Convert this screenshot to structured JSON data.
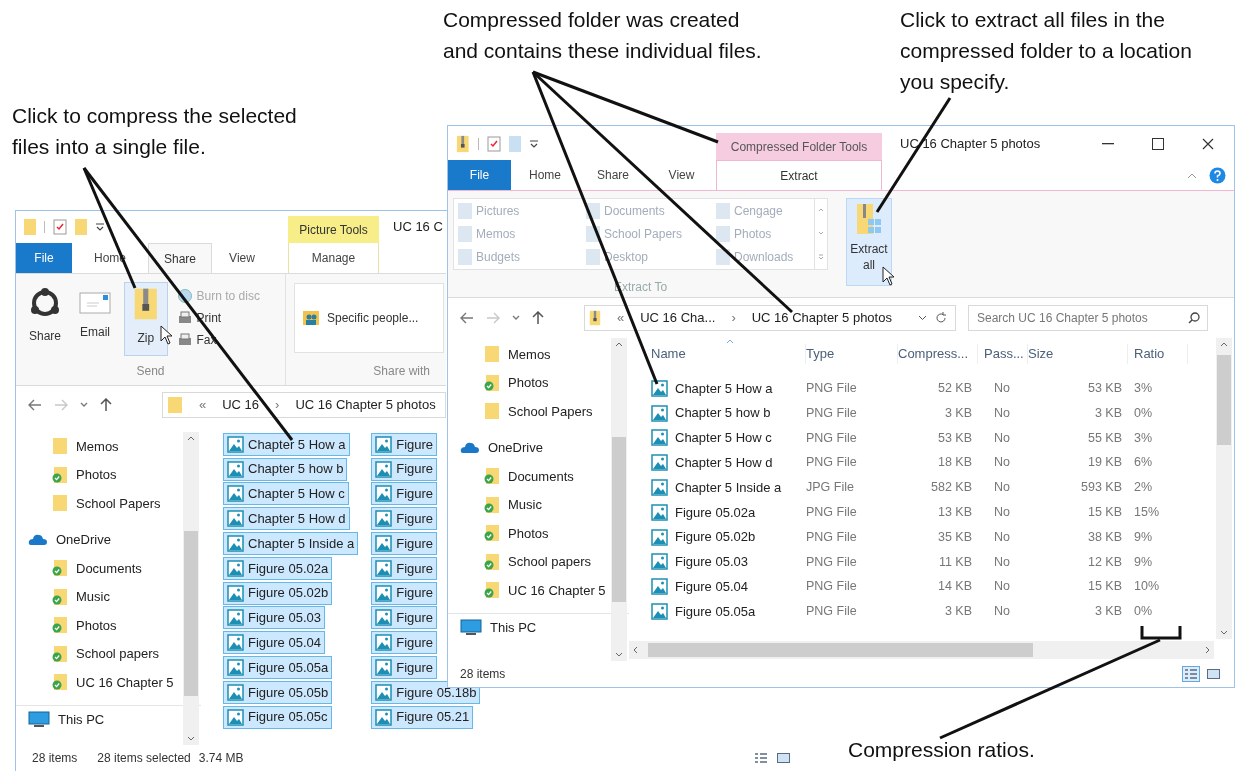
{
  "callouts": [
    {
      "text": "Click to compress the selected files into a single file."
    },
    {
      "text": "Compressed folder was created and contains these individual files."
    },
    {
      "text": "Click to extract all files in the compressed folder to a location you specify."
    },
    {
      "text": "Compression ratios."
    }
  ],
  "left_window": {
    "tool_tab": "Picture Tools",
    "title": "UC 16 C",
    "tabs": [
      {
        "label": "File",
        "kind": "menu",
        "selected": false
      },
      {
        "label": "Home",
        "kind": "tab",
        "selected": false
      },
      {
        "label": "Share",
        "kind": "tab",
        "selected": true
      },
      {
        "label": "View",
        "kind": "tab",
        "selected": false
      },
      {
        "label": "Manage",
        "kind": "contextual",
        "selected": false
      }
    ],
    "commands": [
      {
        "label": "Share",
        "selected": false,
        "disabled": false
      },
      {
        "label": "Email",
        "selected": false,
        "disabled": false
      },
      {
        "label": "Zip",
        "selected": true,
        "disabled": false
      },
      {
        "label": "Burn to disc",
        "selected": false,
        "disabled": true
      },
      {
        "label": "Print",
        "selected": false,
        "disabled": false
      },
      {
        "label": "Fax",
        "selected": false,
        "disabled": false
      }
    ],
    "groups": [
      "Send",
      "Share with"
    ],
    "share_with": "Specific people...",
    "path": [
      "«",
      "UC 16",
      "›",
      "UC 16 Chapter 5 photos"
    ],
    "nav": [
      {
        "label": "Memos",
        "kind": "folder"
      },
      {
        "label": "Photos",
        "kind": "synced"
      },
      {
        "label": "School Papers",
        "kind": "folder"
      },
      {
        "label": "OneDrive",
        "kind": "cloud",
        "children": [
          {
            "label": "Documents",
            "kind": "synced"
          },
          {
            "label": "Music",
            "kind": "synced"
          },
          {
            "label": "Photos",
            "kind": "synced"
          },
          {
            "label": "School papers",
            "kind": "synced"
          },
          {
            "label": "UC 16 Chapter 5",
            "kind": "synced"
          }
        ]
      },
      {
        "label": "This PC",
        "kind": "pc"
      }
    ],
    "files": [
      {
        "name": "Chapter 5 How a",
        "selected": true
      },
      {
        "name": "Chapter 5 how b",
        "selected": true
      },
      {
        "name": "Chapter 5 How c",
        "selected": true
      },
      {
        "name": "Chapter 5 How d",
        "selected": true
      },
      {
        "name": "Chapter 5 Inside a",
        "selected": true
      },
      {
        "name": "Figure 05.02a",
        "selected": true
      },
      {
        "name": "Figure 05.02b",
        "selected": true
      },
      {
        "name": "Figure 05.03",
        "selected": true
      },
      {
        "name": "Figure 05.04",
        "selected": true
      },
      {
        "name": "Figure 05.05a",
        "selected": true
      },
      {
        "name": "Figure 05.05b",
        "selected": true
      },
      {
        "name": "Figure 05.05c",
        "selected": true
      },
      {
        "name": "Figure",
        "selected": true
      },
      {
        "name": "Figure",
        "selected": true
      },
      {
        "name": "Figure",
        "selected": true
      },
      {
        "name": "Figure",
        "selected": true
      },
      {
        "name": "Figure",
        "selected": true
      },
      {
        "name": "Figure",
        "selected": true
      },
      {
        "name": "Figure",
        "selected": true
      },
      {
        "name": "Figure",
        "selected": true
      },
      {
        "name": "Figure",
        "selected": true
      },
      {
        "name": "Figure",
        "selected": true
      },
      {
        "name": "Figure 05.18b",
        "selected": true
      },
      {
        "name": "Figure 05.21",
        "selected": true
      }
    ],
    "status": [
      "28 items",
      "28 items selected",
      "3.74 MB"
    ],
    "view_buttons": [
      {
        "kind": "details",
        "selected": false
      },
      {
        "kind": "large_icons",
        "selected": false
      }
    ]
  },
  "right_window": {
    "tool_tab": "Compressed Folder Tools",
    "title": "UC 16 Chapter 5 photos",
    "tabs": [
      {
        "label": "File",
        "kind": "menu",
        "selected": false
      },
      {
        "label": "Home",
        "kind": "tab",
        "selected": false
      },
      {
        "label": "Share",
        "kind": "tab",
        "selected": false
      },
      {
        "label": "View",
        "kind": "tab",
        "selected": false
      },
      {
        "label": "Extract",
        "kind": "contextual",
        "selected": true
      }
    ],
    "destinations": [
      {
        "label": "Pictures",
        "disabled": true
      },
      {
        "label": "Memos",
        "disabled": true
      },
      {
        "label": "Budgets",
        "disabled": true
      },
      {
        "label": "Documents",
        "disabled": true
      },
      {
        "label": "School Papers",
        "disabled": true
      },
      {
        "label": "Desktop",
        "disabled": true
      },
      {
        "label": "Cengage",
        "disabled": true
      },
      {
        "label": "Photos",
        "disabled": true
      },
      {
        "label": "Downloads",
        "disabled": true
      }
    ],
    "group": "Extract To",
    "extract_all": {
      "label": "Extract all",
      "selected": true
    },
    "path": [
      "«",
      "UC 16 Cha...",
      "›",
      "UC 16 Chapter 5 photos"
    ],
    "search": {
      "placeholder": "Search UC 16 Chapter 5 photos"
    },
    "nav": [
      {
        "label": "Memos",
        "kind": "folder"
      },
      {
        "label": "Photos",
        "kind": "synced"
      },
      {
        "label": "School Papers",
        "kind": "folder"
      },
      {
        "label": "OneDrive",
        "kind": "cloud",
        "children": [
          {
            "label": "Documents",
            "kind": "synced"
          },
          {
            "label": "Music",
            "kind": "synced"
          },
          {
            "label": "Photos",
            "kind": "synced"
          },
          {
            "label": "School papers",
            "kind": "synced"
          },
          {
            "label": "UC 16 Chapter 5",
            "kind": "synced"
          }
        ]
      },
      {
        "label": "This PC",
        "kind": "pc"
      }
    ],
    "columns": [
      "Name",
      "Type",
      "Compress...",
      "Pass...",
      "Size",
      "Ratio"
    ],
    "rows": [
      [
        "Chapter 5 How a",
        "PNG File",
        "52 KB",
        "No",
        "53 KB",
        "3%"
      ],
      [
        "Chapter 5 how b",
        "PNG File",
        "3 KB",
        "No",
        "3 KB",
        "0%"
      ],
      [
        "Chapter 5 How c",
        "PNG File",
        "53 KB",
        "No",
        "55 KB",
        "3%"
      ],
      [
        "Chapter 5 How d",
        "PNG File",
        "18 KB",
        "No",
        "19 KB",
        "6%"
      ],
      [
        "Chapter 5 Inside a",
        "JPG File",
        "582 KB",
        "No",
        "593 KB",
        "2%"
      ],
      [
        "Figure 05.02a",
        "PNG File",
        "13 KB",
        "No",
        "15 KB",
        "15%"
      ],
      [
        "Figure 05.02b",
        "PNG File",
        "35 KB",
        "No",
        "38 KB",
        "9%"
      ],
      [
        "Figure 05.03",
        "PNG File",
        "11 KB",
        "No",
        "12 KB",
        "9%"
      ],
      [
        "Figure 05.04",
        "PNG File",
        "14 KB",
        "No",
        "15 KB",
        "10%"
      ],
      [
        "Figure 05.05a",
        "PNG File",
        "3 KB",
        "No",
        "3 KB",
        "0%"
      ]
    ],
    "status": [
      "28 items"
    ],
    "view_buttons": [
      {
        "kind": "details",
        "selected": true
      },
      {
        "kind": "large_icons",
        "selected": false
      }
    ]
  }
}
